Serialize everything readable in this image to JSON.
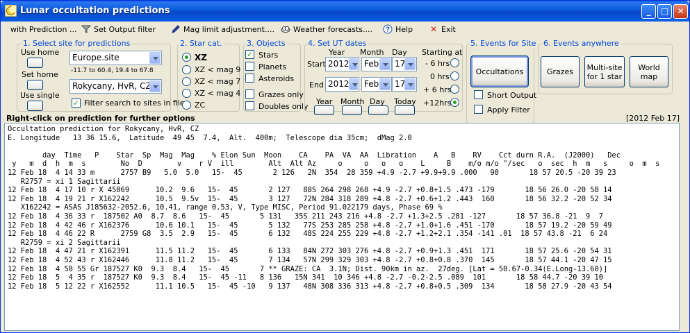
{
  "window": {
    "title": "Lunar occultation predictions"
  },
  "menu": {
    "with_prediction": "with Prediction ...",
    "set_output_filter": "Set Output filter",
    "mag_limit": "Mag limit adjustment....",
    "weather": "Weather forecasts....",
    "help": "Help",
    "exit": "Exit"
  },
  "site": {
    "title": "1.  Select site for predictions",
    "use_home": "Use home",
    "set_home": "Set home",
    "use_single": "Use single",
    "site_file": "Europe.site",
    "range": "-11.7 to 60.4, 19.4 to 67.8",
    "site_name": "Rokycany, HvR, CZ",
    "filter_label": "Filter search to sites in file",
    "filter_checked": "✓"
  },
  "star_cat": {
    "title": "2. Star cat.",
    "options": [
      "XZ",
      "XZ  < mag 9",
      "XZ  < mag 7",
      "XZ  < mag 4",
      "ZC"
    ]
  },
  "objects": {
    "title": "3. Objects",
    "stars": "Stars",
    "stars_checked": "✓",
    "planets": "Planets",
    "asteroids": "Asteroids",
    "grazes_only": "Grazes only",
    "doubles_only": "Doubles only"
  },
  "dates": {
    "title": "4.  Set UT dates",
    "year_hdr": "Year",
    "month_hdr": "Month",
    "day_hdr": "Day",
    "start_label": "Start",
    "end_label": "End",
    "start_year": "2012",
    "start_month": "Feb",
    "start_day": "17",
    "end_year": "2012",
    "end_month": "Feb",
    "end_day": "17",
    "btn_year": "Year",
    "btn_month": "Month",
    "btn_day": "Day",
    "btn_today": "Today",
    "starting_at": "Starting at",
    "offsets": [
      "- 6 hrs",
      "0 hrs",
      "+ 6 hrs",
      "+12hrs"
    ]
  },
  "events_site": {
    "title": "5. Events for Site",
    "occultations": "Occultations",
    "short_output": "Short Output",
    "apply_filter": "Apply Filter"
  },
  "events_anywhere": {
    "title": "6.  Events anywhere",
    "grazes": "Grazes",
    "multisite": "Multi-site\nfor 1 star",
    "world_map": "World\nmap"
  },
  "output": {
    "hint": "Right-click on prediction for further options",
    "date_tag": "[2012 Feb 17]",
    "lines": [
      "Occultation prediction for Rokycany, HvR, CZ",
      "E. Longitude   13 36 15.6,  Latitude  49 45  7.4,  Alt.  400m;  Telescope dia 35cm;  dMag 2.0",
      "",
      "        day  Time   P    Star  Sp  Mag  Mag    % Elon Sun  Moon    CA    PA  VA  AA  Libration    A   B    RV    Cct durn R.A.  (J2000)   Dec",
      " y   m  d  h  m  s        No  D        v    r V  ill        Alt  Alt Az     o     o   o   o    L     B    m/o m/o \"/sec   o  sec  h  m   s     o  m  s",
      "12 Feb 18  4 14 33 m      2757 B9   5.0  5.0   15-  45       2 126   2N  354  28 359 +4.9 -2.7 +9.9+9.9 .000   90       18 57 20.5 -20 39 23",
      "   R2757 = xi 1 Sagittarii",
      "12 Feb 18  4 17 10 r X 45069      10.2  9.6   15-  45       2 127   88S 264 298 268 +4.9 -2.7 +0.8+1.5 .473 -179       18 56 26.0 -20 58 14",
      "12 Feb 18  4 19 21 r X162242      10.5  9.5v  15-  45       3 127   72N 284 318 289 +4.8 -2.7 +0.6+1.2 .443  160       18 56 32.2 -20 52 34",
      "   X162242 = ASAS J185632-2052.6, 10.41, range 0.53, V, Type MISC, Period 91.022179 days, Phase 69 %",
      "12 Feb 18  4 36 33 r  187502 A0  8.7  8.6   15-  45       5 131   35S 211 243 216 +4.8 -2.7 +1.3+2.5 .281 -127       18 57 36.8 -21  9  7",
      "12 Feb 18  4 42 46 r X162376      10.6 10.1   15-  45       5 132   77S 253 285 258 +4.8 -2.7 +1.0+1.6 .451 -170       18 57 19.2 -20 59 49",
      "12 Feb 18  4 46 22 R      2759 G8  3.5  2.9   15-  45       6 132   48S 224 255 229 +4.8 -2.7 +1.2+2.1 .354 -141 .01  18 57 43.8 -21  6 24",
      "   R2759 = xi 2 Sagittarii",
      "12 Feb 18  4 47 21 r X162391      11.5 11.2   15-  45       6 133   84N 272 303 276 +4.8 -2.7 +0.9+1.3 .451  171       18 57 25.6 -20 54 31",
      "12 Feb 18  4 52 43 r X162446      11.8 11.2   15-  45       7 134   57N 299 329 303 +4.8 -2.7 +0.8+0.8 .370  145       18 57 44.1 -20 47 15",
      "12 Feb 18  4 58 55 Gr 187527 K0  9.3  8.4   15-  45       7 ** GRAZE: CA  3.1N; Dist. 90km in az.  27deg. [Lat = 50.67-0.34(E.Long-13.60)]",
      "12 Feb 18  5  4 35 r  187527 K0  9.3  8.4   15-  45 -11   8 136   15N 341  10 346 +4.8 -2.7 -0.2-2.5 .089  101       18 58 44.7 -20 39 10",
      "12 Feb 18  5 12 22 r X162552      11.1 10.5   15-  45 -10   9 137   48N 308 336 313 +4.8 -2.7 +0.8+0.5 .309  134       18 58 27.9 -20 43 54"
    ]
  }
}
